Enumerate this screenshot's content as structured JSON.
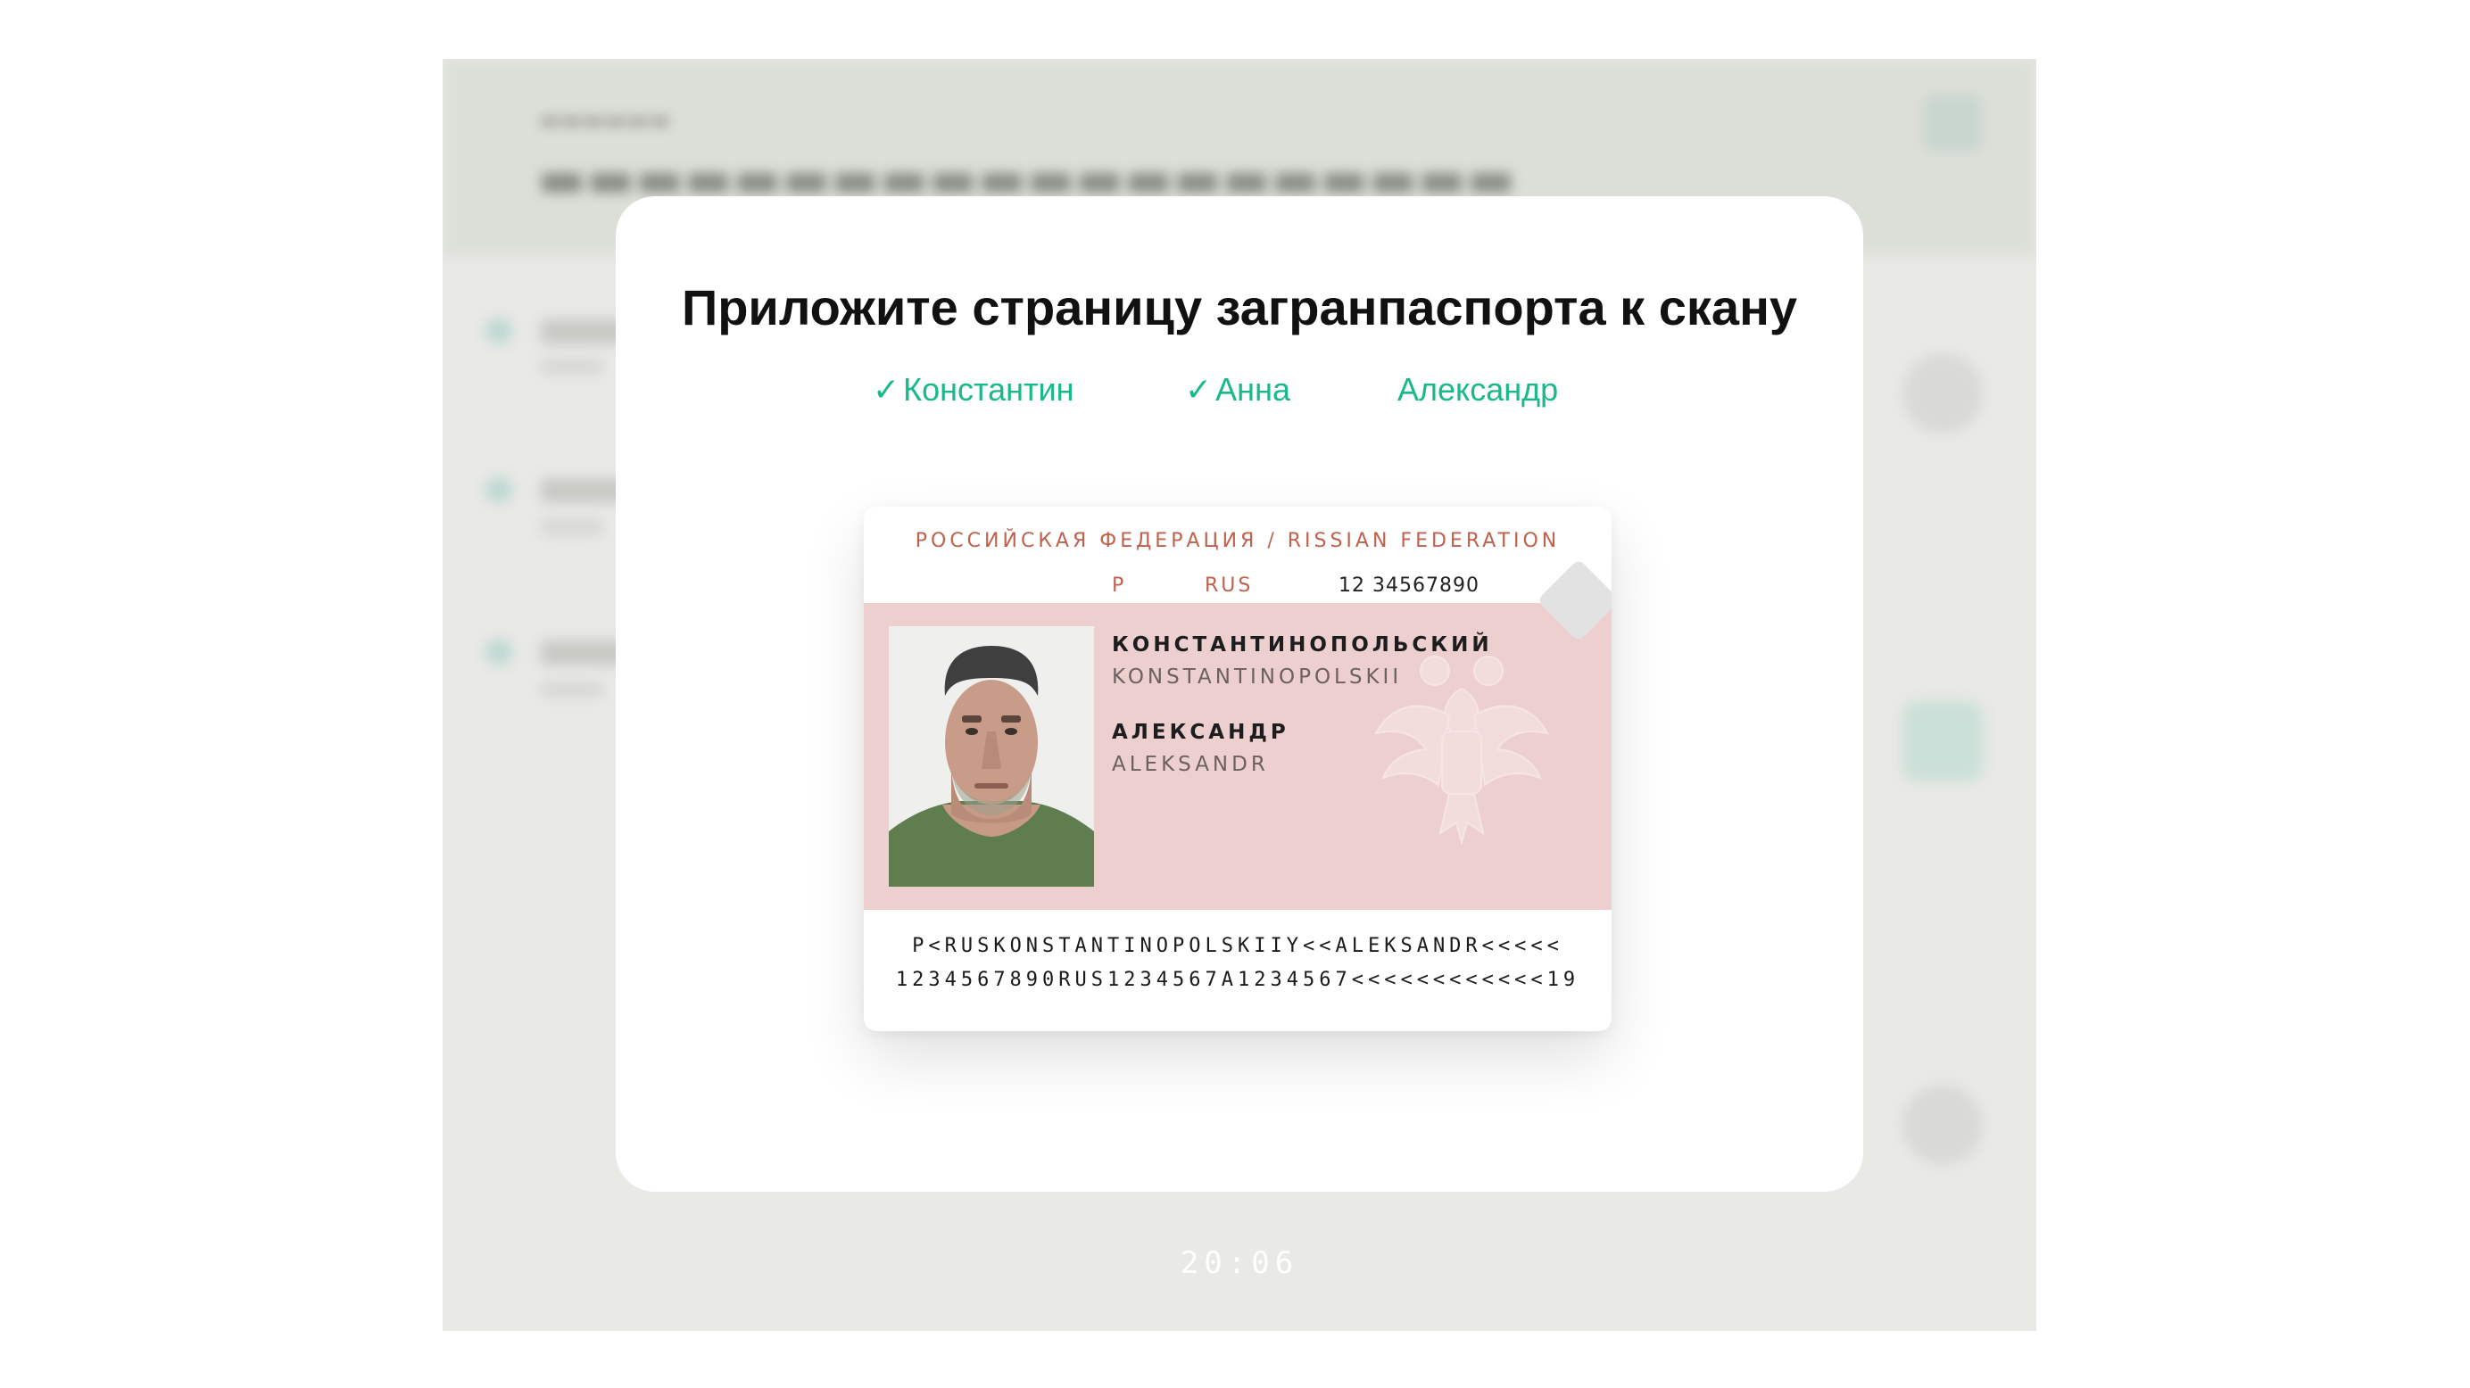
{
  "modal": {
    "title": "Приложите страницу загранпаспорта к скану",
    "tabs": [
      {
        "label": "Константин",
        "check": "✓",
        "done": true
      },
      {
        "label": "Анна",
        "check": "✓",
        "done": true
      },
      {
        "label": "Александр",
        "check": "",
        "done": false
      }
    ]
  },
  "passport": {
    "country": "РОССИЙСКАЯ ФЕДЕРАЦИЯ / RISSIAN FEDERATION",
    "type": "P",
    "state_code": "RUS",
    "number": "12 34567890",
    "surname": "КОНСТАНТИНОПОЛЬСКИЙ",
    "surname_latin": "KONSTANTINOPOLSKII",
    "given_name": "АЛЕКСАНДР",
    "given_name_latin": "ALEKSANDR",
    "mrz_line1": "P<RUSKONSTANTINOPOLSKIIY<<ALEKSANDR<<<<<",
    "mrz_line2": "1234567890RUS1234567A1234567<<<<<<<<<<<<19"
  },
  "footer": {
    "clock": "20:06"
  },
  "colors": {
    "accent": "#19b98c",
    "passport_red": "#c0614e",
    "passport_band": "#edcfcf",
    "backdrop": "#e9e9e6"
  },
  "icons": [
    "check-icon",
    "coat-of-arms-emblem"
  ]
}
